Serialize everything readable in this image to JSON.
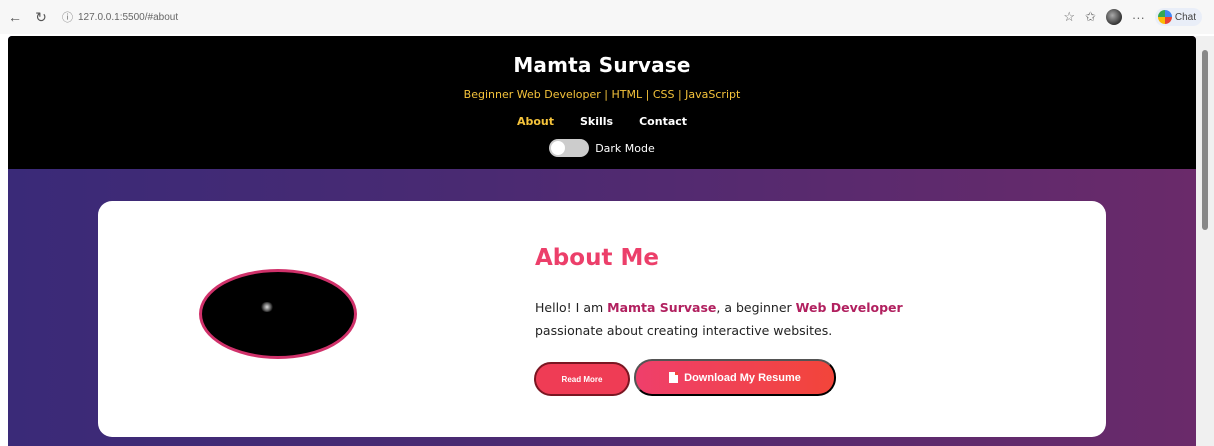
{
  "browser": {
    "url": "127.0.0.1:5500/#about",
    "chat_label": "Chat"
  },
  "header": {
    "title": "Mamta Survase",
    "tagline": "Beginner Web Developer | HTML | CSS | JavaScript",
    "nav": [
      {
        "label": "About",
        "active": true
      },
      {
        "label": "Skills",
        "active": false
      },
      {
        "label": "Contact",
        "active": false
      }
    ],
    "dark_mode_label": "Dark Mode",
    "dark_mode_on": false
  },
  "about": {
    "heading": "About Me",
    "text_1": "Hello! I am ",
    "name": "Mamta Survase",
    "text_2": ", a beginner ",
    "role": "Web Developer",
    "text_3": " passionate about creating interactive websites.",
    "read_more_label": "Read More",
    "resume_label": "Download My Resume"
  },
  "colors": {
    "accent": "#ec3f6a",
    "highlight": "#b1205f",
    "nav_active": "#f5c33b"
  }
}
